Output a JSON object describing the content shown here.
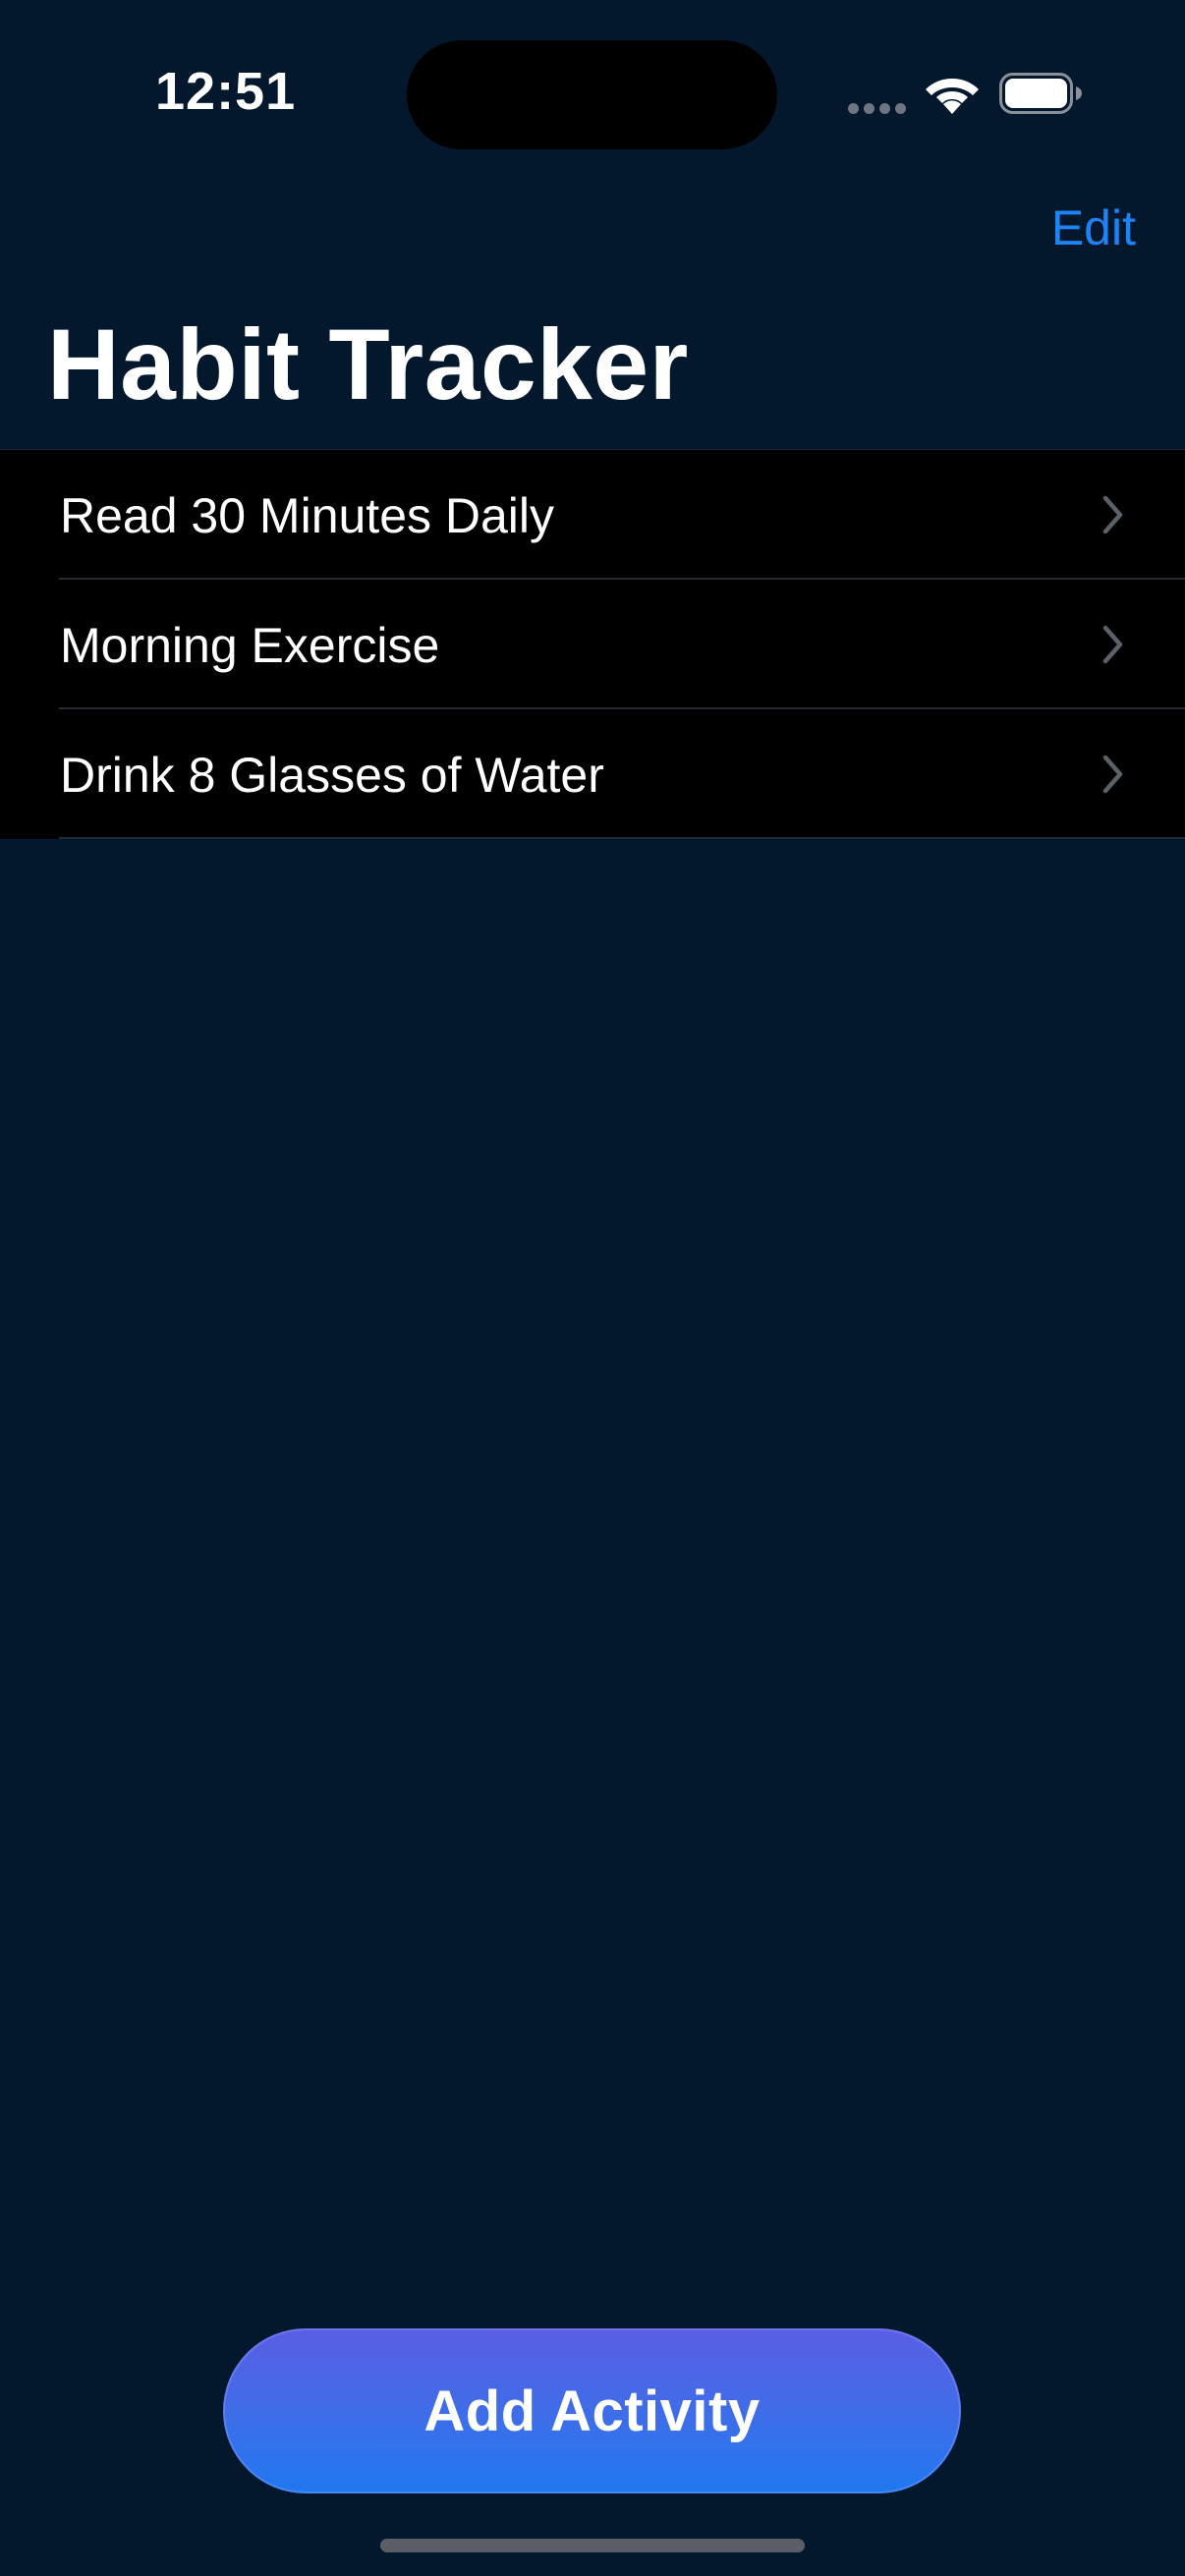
{
  "status_bar": {
    "time": "12:51"
  },
  "nav": {
    "edit_label": "Edit",
    "title": "Habit Tracker"
  },
  "habits": [
    {
      "label": "Read 30 Minutes Daily"
    },
    {
      "label": "Morning Exercise"
    },
    {
      "label": "Drink 8 Glasses of Water"
    }
  ],
  "actions": {
    "add_label": "Add Activity"
  },
  "colors": {
    "background": "#03172d",
    "accent": "#1d84f5",
    "list_background": "#000000",
    "button_gradient_top": "#5a5ee3",
    "button_gradient_bottom": "#1f78ee"
  },
  "icons": {
    "row_chevron": "chevron-right-icon",
    "wifi": "wifi-icon",
    "battery": "battery-icon",
    "signal": "cellular-signal-icon"
  }
}
